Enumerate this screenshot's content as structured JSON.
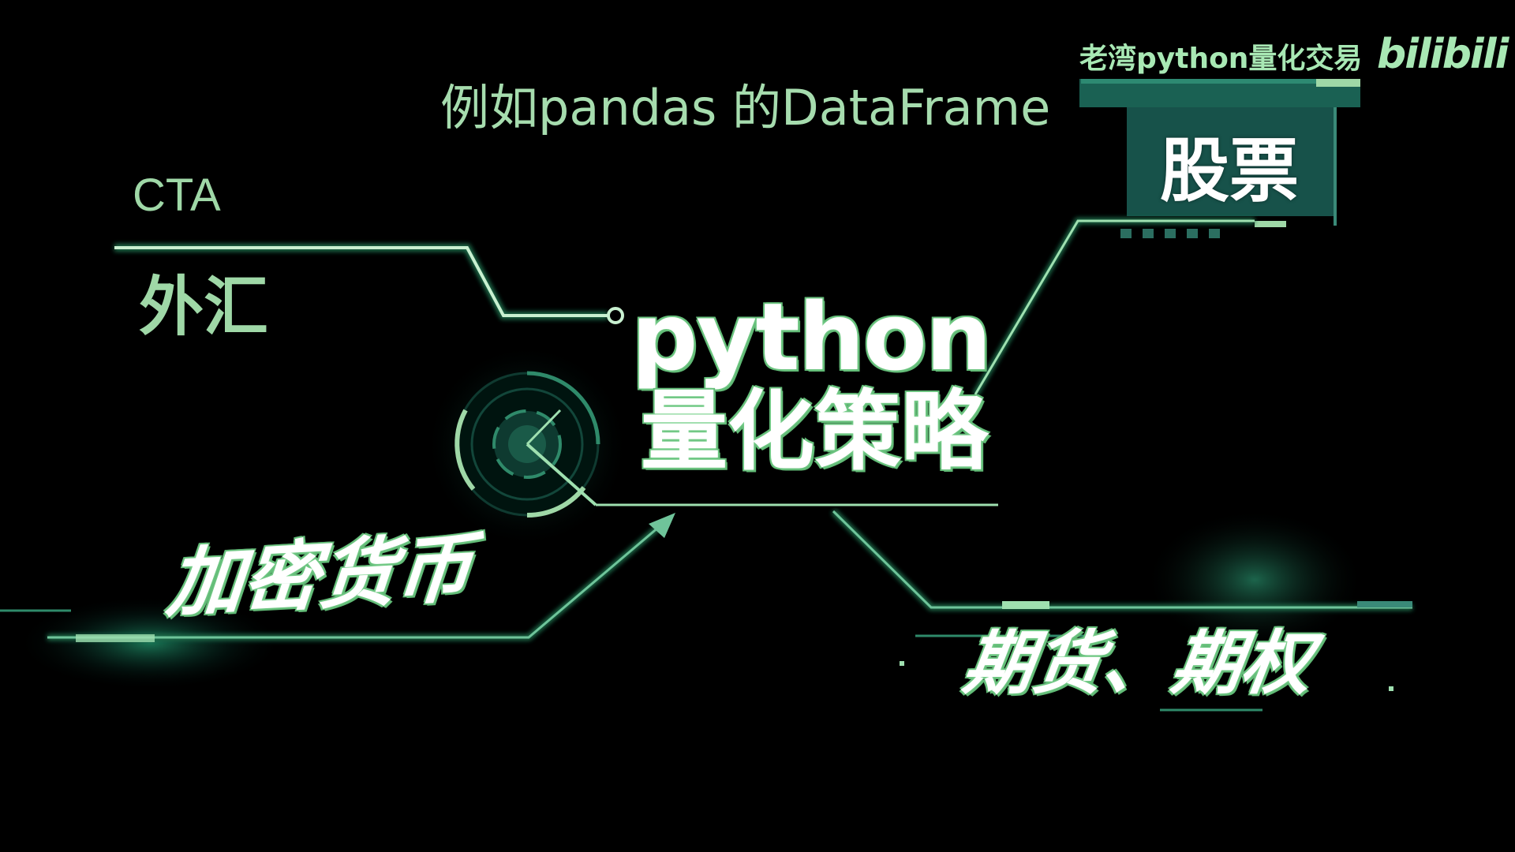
{
  "subtitle": "例如pandas 的DataFrame",
  "watermark": {
    "channel_name": "老湾python量化交易",
    "platform_logo_text": "bilibili"
  },
  "title": {
    "line1": "python",
    "line2": "量化策略"
  },
  "markets": {
    "cta": "CTA",
    "forex": "外汇",
    "stocks": "股票",
    "crypto": "加密货币",
    "futures_options": "期货、期权"
  },
  "colors": {
    "background": "#000000",
    "accent_green": "#9fd8a7",
    "dark_teal": "#17524a",
    "glow_teal": "#1f7a6a",
    "title_fill": "#ffffff"
  },
  "icons": [
    "target-reticle-icon",
    "arrow-up-right-icon",
    "circuit-node-icon"
  ]
}
